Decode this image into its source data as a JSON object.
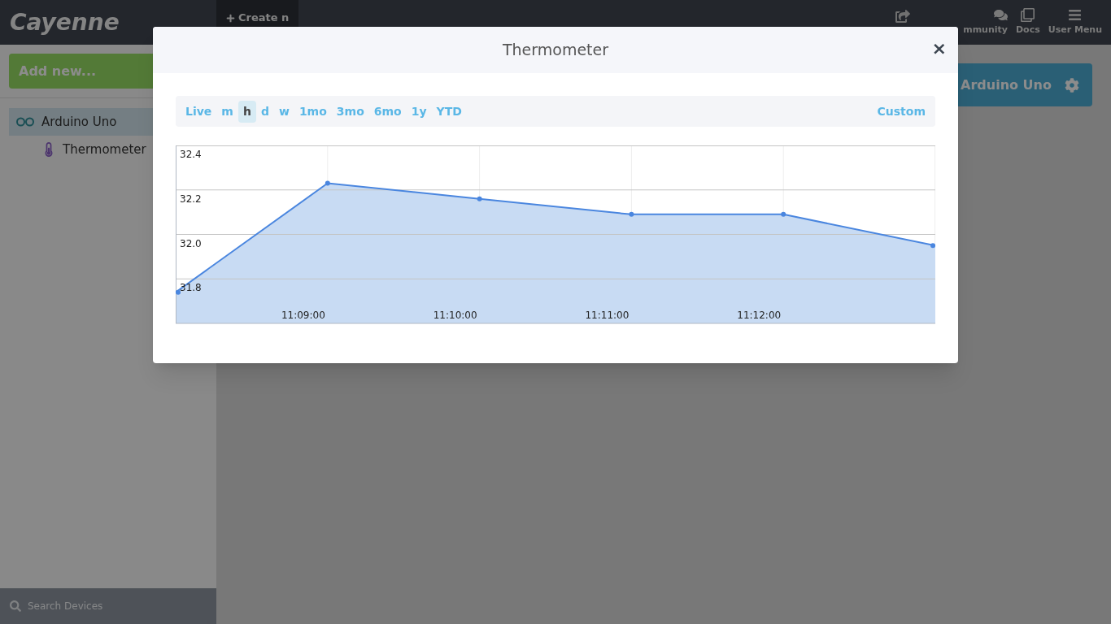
{
  "header": {
    "logo": "Cayenne",
    "create_button": "Create n",
    "nav": [
      {
        "label": "mmunity"
      },
      {
        "label": "Docs"
      },
      {
        "label": "User Menu"
      }
    ]
  },
  "sidebar": {
    "add_button": "Add new...",
    "tree": [
      {
        "label": "Arduino Uno",
        "selected": true,
        "children": [
          {
            "label": "Thermometer",
            "selected": false
          }
        ]
      }
    ],
    "search": {
      "placeholder": "Search Devices"
    }
  },
  "main": {
    "device_button": "Arduino Uno"
  },
  "modal": {
    "title": "Thermometer",
    "close": "×",
    "ranges": [
      {
        "label": "Live",
        "selected": false
      },
      {
        "label": "m",
        "selected": false
      },
      {
        "label": "h",
        "selected": true
      },
      {
        "label": "d",
        "selected": false
      },
      {
        "label": "w",
        "selected": false
      },
      {
        "label": "1mo",
        "selected": false
      },
      {
        "label": "3mo",
        "selected": false
      },
      {
        "label": "6mo",
        "selected": false
      },
      {
        "label": "1y",
        "selected": false
      },
      {
        "label": "YTD",
        "selected": false
      }
    ],
    "custom": "Custom",
    "chart_data": {
      "type": "area",
      "categories": [
        null,
        "11:09:00",
        "11:10:00",
        "11:11:00",
        "11:12:00",
        null
      ],
      "series": [
        {
          "color": "#4a86df",
          "values": [
            31.74,
            32.23,
            32.16,
            32.09,
            32.09,
            31.95
          ]
        }
      ],
      "ylim": [
        31.6,
        32.4
      ],
      "grid": true,
      "yticks": [
        {
          "value": 31.8,
          "label": "31.8"
        },
        {
          "value": 32.0,
          "label": "32.0"
        },
        {
          "value": 32.2,
          "label": "32.2"
        },
        {
          "value": 32.4,
          "label": "32.4"
        }
      ]
    }
  }
}
